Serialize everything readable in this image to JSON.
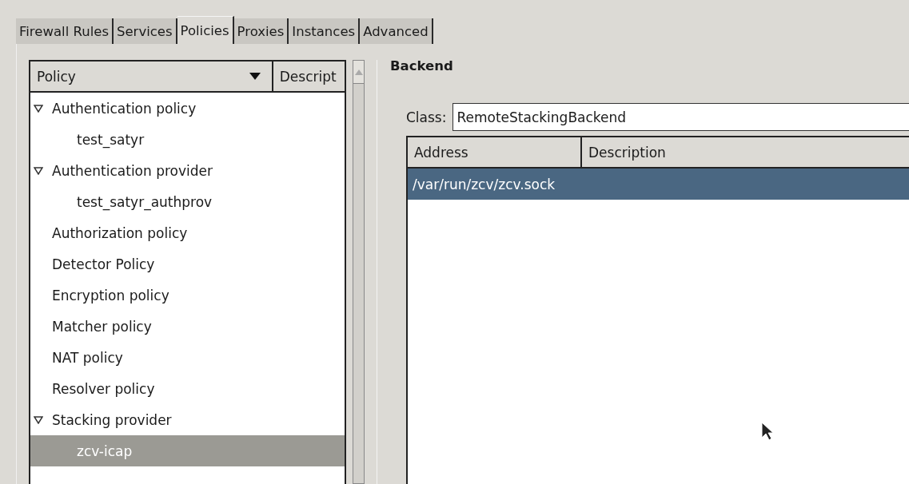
{
  "tabs": [
    {
      "label": "Firewall Rules",
      "selected": false
    },
    {
      "label": "Services",
      "selected": false
    },
    {
      "label": "Policies",
      "selected": true
    },
    {
      "label": "Proxies",
      "selected": false
    },
    {
      "label": "Instances",
      "selected": false
    },
    {
      "label": "Advanced",
      "selected": false
    }
  ],
  "policy_tree": {
    "columns": [
      "Policy",
      "Descript"
    ],
    "items": [
      {
        "label": "Authentication policy",
        "expanded": true,
        "selected": false,
        "children": [
          {
            "label": "test_satyr",
            "selected": false
          }
        ]
      },
      {
        "label": "Authentication provider",
        "expanded": true,
        "selected": false,
        "children": [
          {
            "label": "test_satyr_authprov",
            "selected": false
          }
        ]
      },
      {
        "label": "Authorization policy",
        "selected": false
      },
      {
        "label": "Detector Policy",
        "selected": false
      },
      {
        "label": "Encryption policy",
        "selected": false
      },
      {
        "label": "Matcher policy",
        "selected": false
      },
      {
        "label": "NAT policy",
        "selected": false
      },
      {
        "label": "Resolver policy",
        "selected": false
      },
      {
        "label": "Stacking provider",
        "expanded": true,
        "selected": false,
        "children": [
          {
            "label": "zcv-icap",
            "selected": true
          }
        ]
      }
    ]
  },
  "backend": {
    "title": "Backend",
    "class_label": "Class:",
    "class_value": "RemoteStackingBackend",
    "table": {
      "columns": [
        "Address",
        "Description"
      ],
      "rows": [
        {
          "address": "/var/run/zcv/zcv.sock",
          "selected": true
        }
      ]
    }
  }
}
